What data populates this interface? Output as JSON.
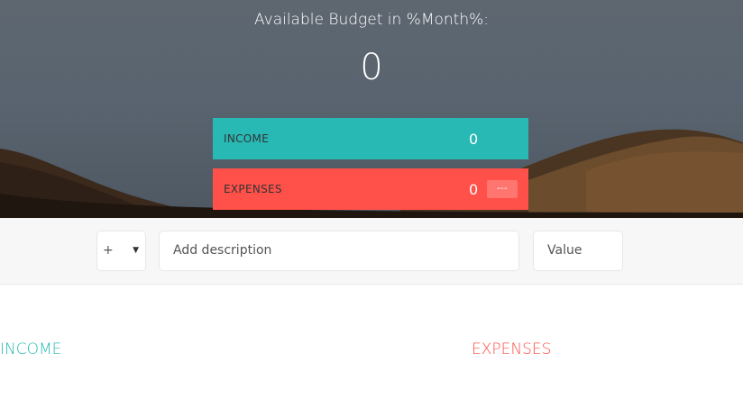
{
  "budget": {
    "title": "Available Budget in %Month%:",
    "value": "0"
  },
  "summary": {
    "income": {
      "label": "INCOME",
      "value": "0",
      "color": "#28b9b5"
    },
    "expenses": {
      "label": "EXPENSES",
      "value": "0",
      "percentage": "---",
      "color": "#ff5049"
    }
  },
  "add": {
    "type_selected": "+",
    "type_icon": "chevron-down-icon",
    "description_placeholder": "Add description",
    "value_placeholder": "Value"
  },
  "lists": {
    "income_title": "INCOME",
    "expenses_title": "EXPENSES"
  }
}
